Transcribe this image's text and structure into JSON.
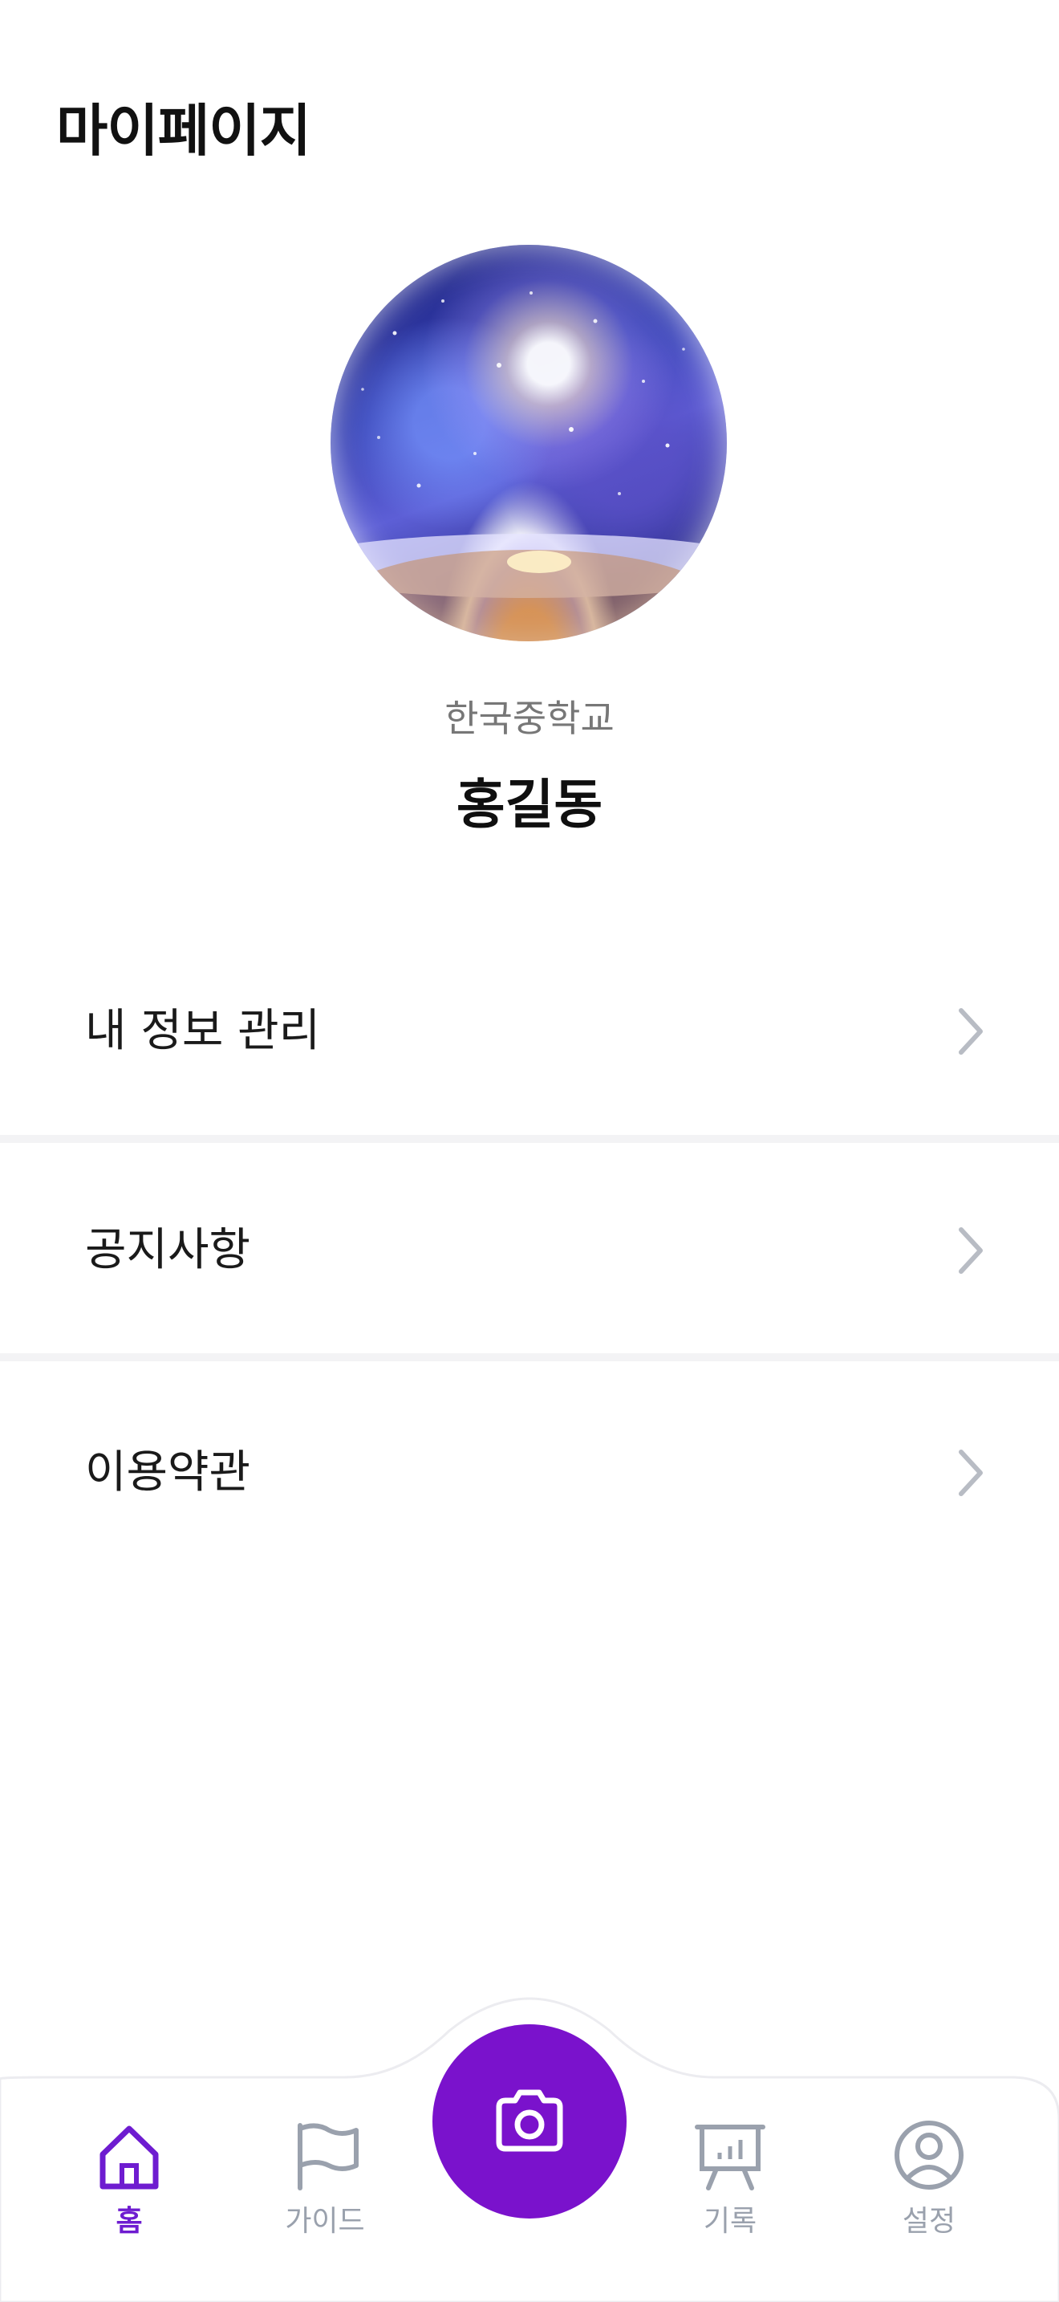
{
  "header": {
    "title": "마이페이지"
  },
  "profile": {
    "school": "한국중학교",
    "name": "홍길동"
  },
  "menu": {
    "items": [
      {
        "label": "내 정보 관리"
      },
      {
        "label": "공지사항"
      },
      {
        "label": "이용약관"
      }
    ]
  },
  "tab_bar": {
    "tabs": [
      {
        "label": "홈",
        "icon": "home-icon",
        "active": true
      },
      {
        "label": "가이드",
        "icon": "flag-icon",
        "active": false
      },
      {
        "label": "기록",
        "icon": "chart-board-icon",
        "active": false
      },
      {
        "label": "설정",
        "icon": "user-circle-icon",
        "active": false
      }
    ],
    "center_action_icon": "camera-icon"
  },
  "colors": {
    "accent": "#7a12cc",
    "active_tab": "#6e1cd0",
    "inactive_tab": "#9aa1ad",
    "chevron": "#b8bcc4",
    "divider": "#f3f3f5"
  }
}
